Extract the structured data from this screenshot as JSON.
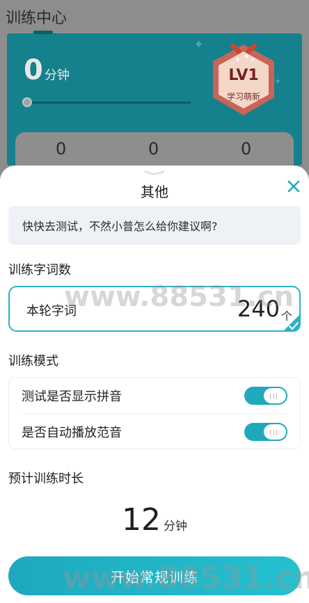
{
  "background": {
    "title": "训练中心",
    "minutes_value": "0",
    "minutes_unit": "分钟",
    "badge": {
      "level": "LV1",
      "subtitle": "学习萌新"
    },
    "stats": [
      "0",
      "0",
      "0"
    ]
  },
  "sheet": {
    "title": "其他",
    "tip": "快快去测试，不然小普怎么给你建议啊?",
    "word_count": {
      "section_label": "训练字词数",
      "field_label": "本轮字词",
      "value": "240",
      "unit": "个"
    },
    "mode": {
      "section_label": "训练模式",
      "options": [
        {
          "label": "测试是否显示拼音",
          "enabled": true
        },
        {
          "label": "是否自动播放范音",
          "enabled": true
        }
      ]
    },
    "duration": {
      "section_label": "预计训练时长",
      "value": "12",
      "unit": "分钟"
    },
    "start_button": "开始常规训练"
  },
  "watermarks": {
    "middle": "www.88531.cn",
    "bottom": "www.88531.cn"
  },
  "colors": {
    "accent": "#1fa9bd",
    "tip_bg": "#eef1f5",
    "badge": "#e8604c"
  }
}
